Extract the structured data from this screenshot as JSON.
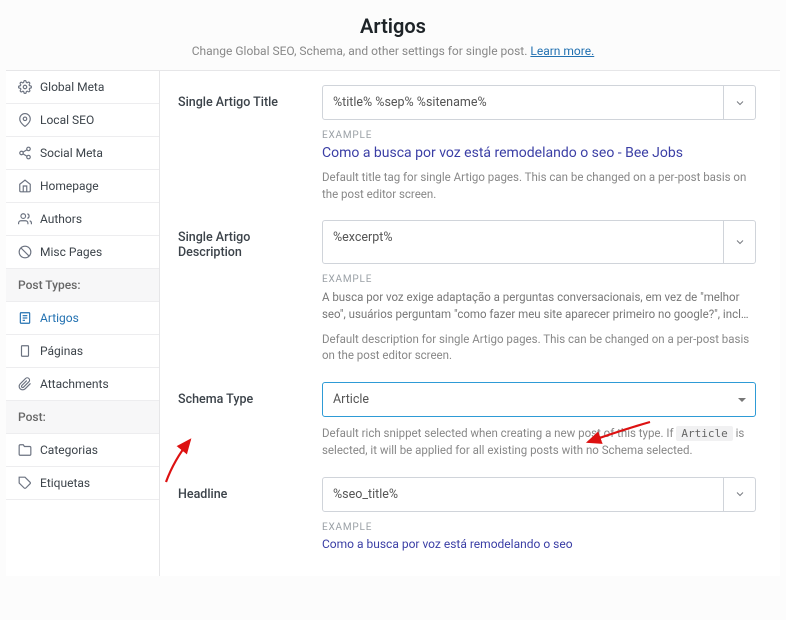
{
  "header": {
    "title": "Artigos",
    "subtitle_prefix": "Change Global SEO, Schema, and other settings for single post. ",
    "learn_more": "Learn more."
  },
  "sidebar": {
    "groups": [
      {
        "header": null,
        "items": [
          {
            "icon": "gear-icon",
            "label": "Global Meta"
          },
          {
            "icon": "pin-icon",
            "label": "Local SEO"
          },
          {
            "icon": "share-icon",
            "label": "Social Meta"
          },
          {
            "icon": "home-icon",
            "label": "Homepage"
          },
          {
            "icon": "users-icon",
            "label": "Authors"
          },
          {
            "icon": "forbidden-icon",
            "label": "Misc Pages"
          }
        ]
      },
      {
        "header": "Post Types:",
        "items": [
          {
            "icon": "post-icon",
            "label": "Artigos",
            "active": true
          },
          {
            "icon": "page-icon",
            "label": "Páginas"
          },
          {
            "icon": "attach-icon",
            "label": "Attachments"
          }
        ]
      },
      {
        "header": "Post:",
        "items": [
          {
            "icon": "folder-icon",
            "label": "Categorias"
          },
          {
            "icon": "tag-icon",
            "label": "Etiquetas"
          }
        ]
      }
    ]
  },
  "fields": {
    "title": {
      "label": "Single Artigo Title",
      "value": "%title% %sep% %sitename%",
      "example_label": "EXAMPLE",
      "example_link": "Como a busca por voz está remodelando o seo - Bee Jobs",
      "help": "Default title tag for single Artigo pages. This can be changed on a per-post basis on the post editor screen."
    },
    "description": {
      "label": "Single Artigo Description",
      "value": "%excerpt%",
      "example_label": "EXAMPLE",
      "example_text": "A busca por voz exige adaptação a perguntas conversacionais, em vez de \"melhor seo\", usuários perguntam \"como fazer meu site aparecer primeiro no google?\", incl…",
      "help": "Default description for single Artigo pages. This can be changed on a per-post basis on the post editor screen."
    },
    "schema": {
      "label": "Schema Type",
      "value": "Article",
      "help_prefix": "Default rich snippet selected when creating a new post of this type. If ",
      "code": "Article",
      "help_suffix": " is selected, it will be applied for all existing posts with no Schema selected."
    },
    "headline": {
      "label": "Headline",
      "value": "%seo_title%",
      "example_label": "EXAMPLE",
      "example_link": "Como a busca por voz está remodelando o seo"
    }
  }
}
